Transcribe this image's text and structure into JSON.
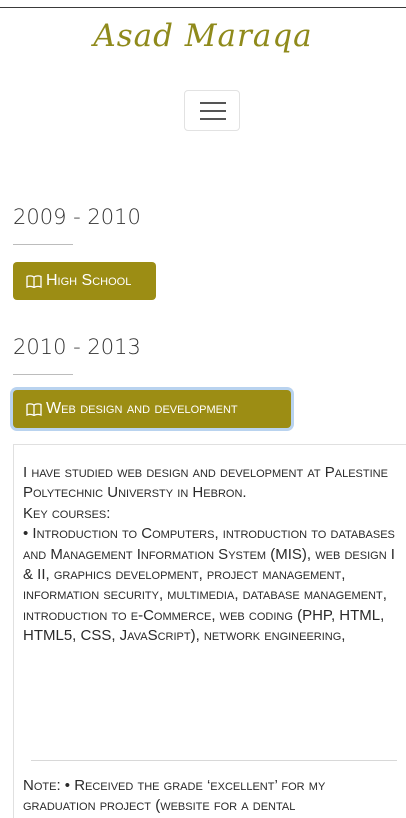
{
  "brand": {
    "name": "Asad Maraqa"
  },
  "nav": {
    "toggle_icon": "hamburger-icon"
  },
  "timeline": [
    {
      "period": "2009 - 2010",
      "button_label": "High School",
      "icon": "book-icon"
    },
    {
      "period": "2010 - 2013",
      "button_label": "Web design and development",
      "icon": "book-icon"
    }
  ],
  "details": {
    "paragraphs": [
      "I have studied web design and development at Palestine Polytechnic Universty in Hebron.",
      "Key courses:",
      "• Introduction to Computers, introduction to databases and Management Information System (MIS), web design I & II, graphics development, project management, information security, multimedia, database management, introduction to e-Commerce, web coding (PHP, HTML, HTML5, CSS, JavaScript), network engineering,"
    ],
    "note": "Note: • Received the grade ‘excellent’ for my graduation project (website for a dental"
  },
  "colors": {
    "accent": "#9c8d14",
    "brand_text": "#8f8a1b",
    "focus_ring": "#b9d3ef"
  }
}
